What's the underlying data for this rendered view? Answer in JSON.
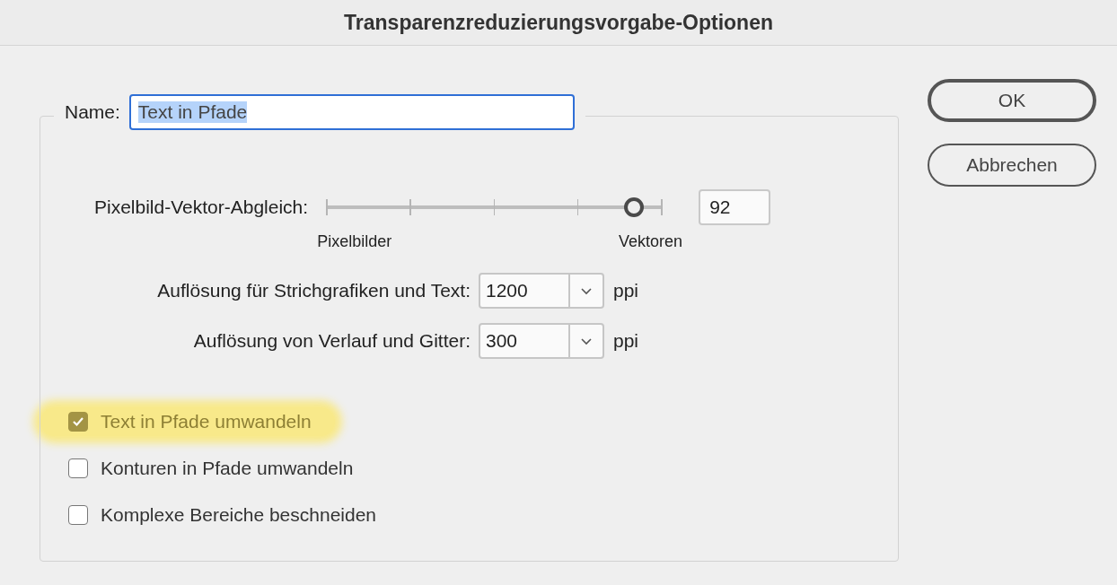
{
  "window": {
    "title": "Transparenzreduzierungsvorgabe-Optionen"
  },
  "name_field": {
    "label": "Name:",
    "value": "Text in Pfade",
    "selected": true
  },
  "slider": {
    "label": "Pixelbild-Vektor-Abgleich:",
    "level": 0.92,
    "value": "92",
    "min_label": "Pixelbilder",
    "max_label": "Vektoren"
  },
  "resolutions": [
    {
      "label": "Auflösung für Strichgrafiken und Text:",
      "value": "1200",
      "unit": "ppi"
    },
    {
      "label": "Auflösung von Verlauf und Gitter:",
      "value": "300",
      "unit": "ppi"
    }
  ],
  "checkboxes": [
    {
      "label": "Text in Pfade umwandeln",
      "checked": true,
      "highlighted": true
    },
    {
      "label": "Konturen in Pfade umwandeln",
      "checked": false,
      "highlighted": false
    },
    {
      "label": "Komplexe Bereiche beschneiden",
      "checked": false,
      "highlighted": false
    }
  ],
  "buttons": [
    {
      "label": "OK",
      "default": true
    },
    {
      "label": "Abbrechen",
      "default": false
    }
  ]
}
